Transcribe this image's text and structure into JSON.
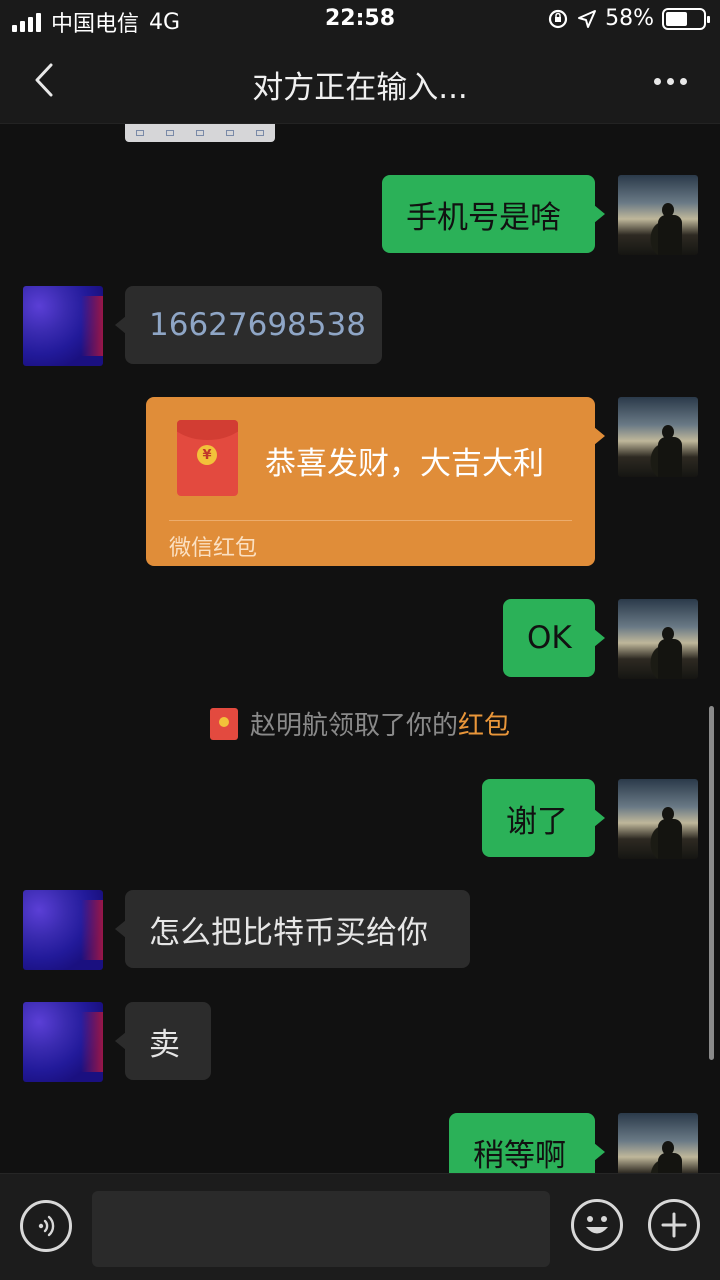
{
  "status_bar": {
    "carrier": "中国电信",
    "network": "4G",
    "time": "22:58",
    "battery": "58%",
    "battery_level": 0.58
  },
  "header": {
    "title": "对方正在输入...",
    "back_icon": "chevron-left-icon",
    "more_icon": "more-dots-icon"
  },
  "messages": [
    {
      "side": "out",
      "text": "手机号是啥"
    },
    {
      "side": "in",
      "text": "16627698538"
    },
    {
      "side": "out",
      "type": "red-packet",
      "text": "恭喜发财，大吉大利",
      "label": "微信红包"
    },
    {
      "side": "out",
      "text": "OK"
    },
    {
      "type": "system",
      "text": "赵明航领取了你的",
      "link": "红包"
    },
    {
      "side": "out",
      "text": "谢了"
    },
    {
      "side": "in",
      "text": "怎么把比特币买给你"
    },
    {
      "side": "in",
      "text": "卖"
    },
    {
      "side": "out",
      "text": "稍等啊"
    }
  ],
  "input_bar": {
    "placeholder": "",
    "voice_icon": "voice-icon",
    "emoji_icon": "emoji-icon",
    "plus_icon": "plus-icon"
  },
  "colors": {
    "outgoing_bubble": "#2bb158",
    "incoming_bubble": "#2c2c2c",
    "red_packet": "#e08d39",
    "link": "#e9963a",
    "background": "#111111"
  }
}
